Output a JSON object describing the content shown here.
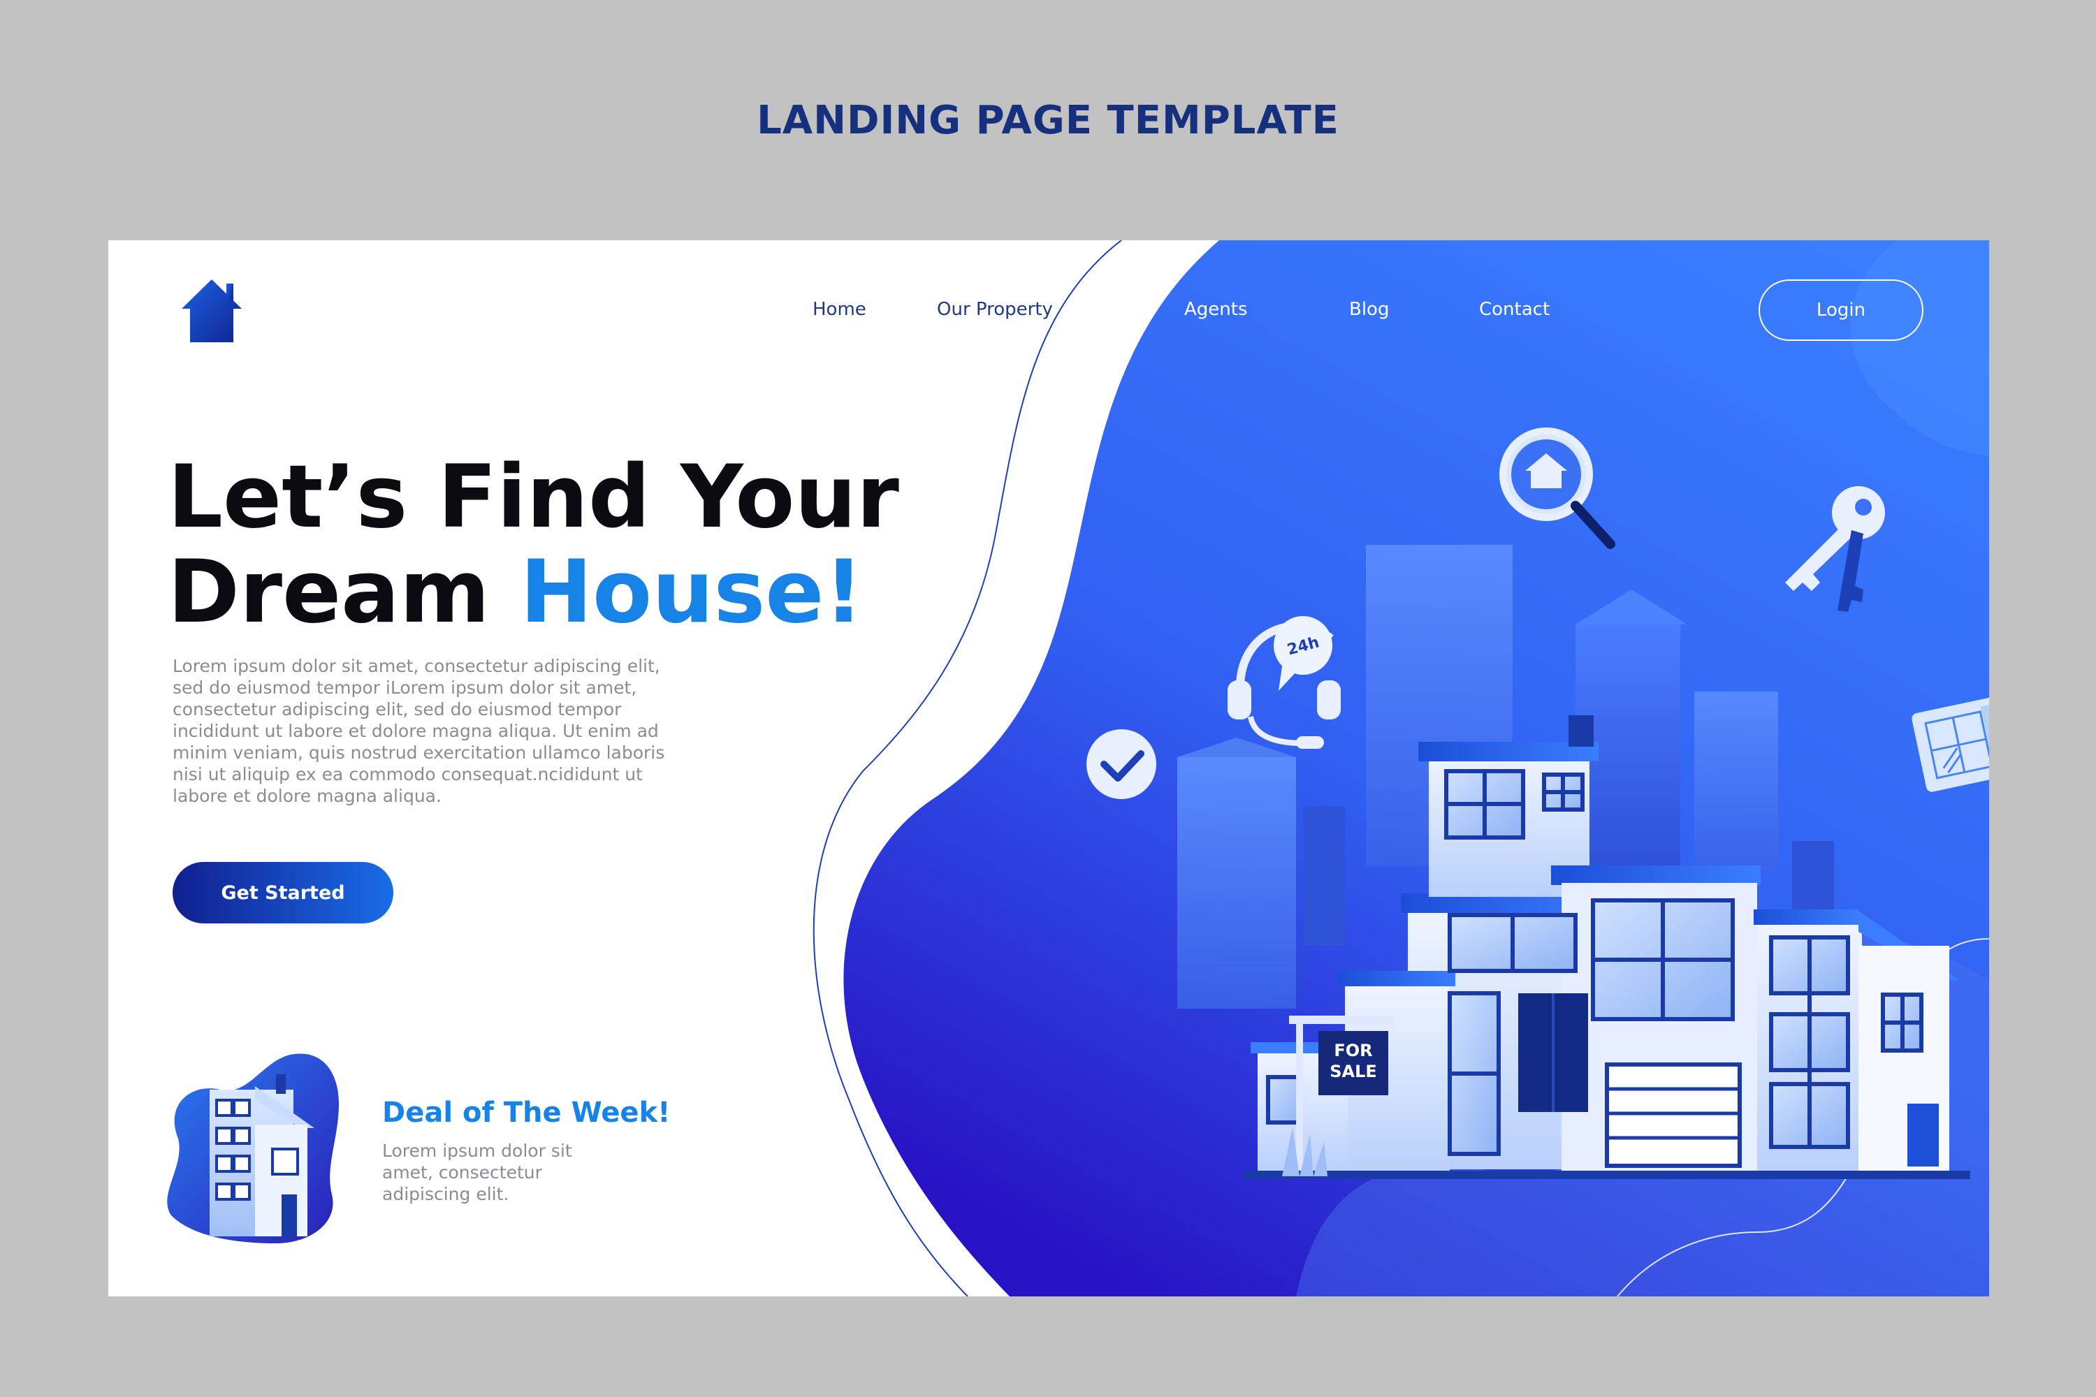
{
  "template_title": "LANDING PAGE TEMPLATE",
  "nav": {
    "home": "Home",
    "our_property": "Our Property",
    "agents": "Agents",
    "blog": "Blog",
    "contact": "Contact",
    "login": "Login"
  },
  "hero": {
    "title_line1": "Let’s Find Your",
    "title_line2_prefix": "Dream ",
    "title_line2_accent": "House!",
    "body": "Lorem ipsum dolor sit amet, consectetur adipiscing elit, sed do eiusmod tempor iLorem ipsum dolor sit amet, consectetur adipiscing elit, sed do eiusmod tempor incididunt ut labore et dolore magna aliqua. Ut enim ad minim veniam, quis nostrud exercitation ullamco laboris nisi ut aliquip ex ea commodo consequat.ncididunt ut labore et dolore magna aliqua.",
    "cta_label": "Get Started"
  },
  "deal": {
    "title": "Deal of The Week!",
    "body": "Lorem ipsum dolor sit amet, consectetur adipiscing elit."
  },
  "illustration": {
    "sign_line1": "FOR",
    "sign_line2": "SALE",
    "badge_24h": "24h"
  },
  "icons": [
    "house-logo-icon",
    "magnifier-house-icon",
    "key-icon",
    "headset-24h-icon",
    "checkmark-icon",
    "blueprint-icon"
  ],
  "colors": {
    "page_bg": "#c2c2c2",
    "title_navy": "#16307e",
    "accent_blue": "#1883e6",
    "hero_gradient_start": "#3a7bff",
    "hero_gradient_end": "#2a17c7"
  }
}
